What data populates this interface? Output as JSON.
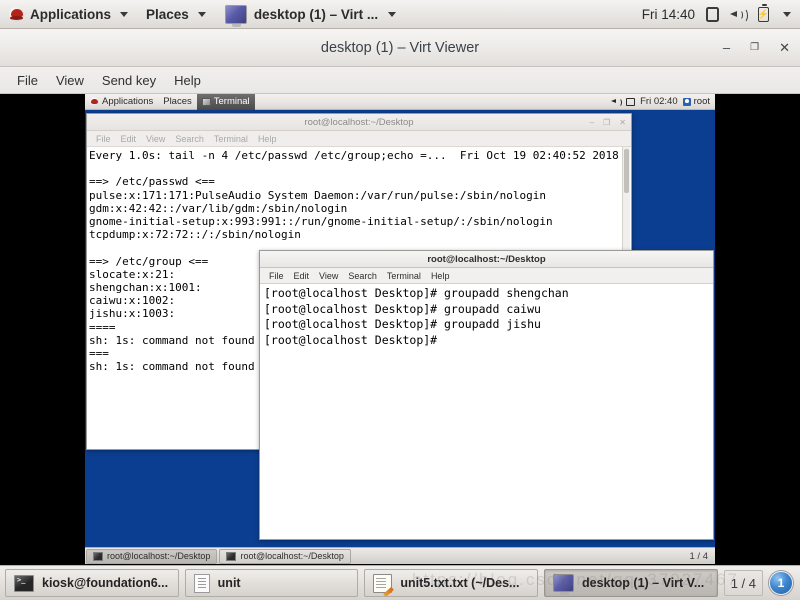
{
  "host_panel": {
    "applications": "Applications",
    "places": "Places",
    "window_title": "desktop (1) – Virt ...",
    "clock": "Fri 14:40",
    "icons": [
      "hat-icon",
      "chevron-down-icon",
      "display-icon",
      "network-icon",
      "volume-icon",
      "battery-icon"
    ]
  },
  "virt_viewer": {
    "title": "desktop (1) – Virt Viewer",
    "buttons": {
      "minimize": "–",
      "maximize": "❐",
      "close": "✕"
    },
    "menu": [
      "File",
      "View",
      "Send key",
      "Help"
    ]
  },
  "guest_panel": {
    "applications": "Applications",
    "places": "Places",
    "task": "Terminal",
    "clock": "Fri 02:40",
    "user": "root"
  },
  "bg_terminal": {
    "title": "root@localhost:~/Desktop",
    "menu": [
      "File",
      "Edit",
      "View",
      "Search",
      "Terminal",
      "Help"
    ],
    "lines": [
      "Every 1.0s: tail -n 4 /etc/passwd /etc/group;echo =...  Fri Oct 19 02:40:52 2018",
      "",
      "==> /etc/passwd <==",
      "pulse:x:171:171:PulseAudio System Daemon:/var/run/pulse:/sbin/nologin",
      "gdm:x:42:42::/var/lib/gdm:/sbin/nologin",
      "gnome-initial-setup:x:993:991::/run/gnome-initial-setup/:/sbin/nologin",
      "tcpdump:x:72:72::/:/sbin/nologin",
      "",
      "==> /etc/group <==",
      "slocate:x:21:",
      "shengchan:x:1001:",
      "caiwu:x:1002:",
      "jishu:x:1003:",
      "====",
      "sh: 1s: command not found",
      "===",
      "sh: 1s: command not found"
    ]
  },
  "fg_terminal": {
    "title": "root@localhost:~/Desktop",
    "menu": [
      "File",
      "Edit",
      "View",
      "Search",
      "Terminal",
      "Help"
    ],
    "lines": [
      "[root@localhost Desktop]# groupadd shengchan",
      "[root@localhost Desktop]# groupadd caiwu",
      "[root@localhost Desktop]# groupadd jishu",
      "[root@localhost Desktop]#"
    ]
  },
  "guest_taskbar": {
    "items": [
      "root@localhost:~/Desktop",
      "root@localhost:~/Desktop"
    ],
    "workspace": "1 / 4"
  },
  "host_taskbar": {
    "items": [
      {
        "label": "kiosk@foundation6...",
        "icon": "terminal-icon",
        "active": false
      },
      {
        "label": "unit",
        "icon": "file-manager-icon",
        "active": false
      },
      {
        "label": "unit5.txt.txt (~/Des...",
        "icon": "text-editor-icon",
        "active": false
      },
      {
        "label": "desktop (1) – Virt V...",
        "icon": "virt-viewer-icon",
        "active": true
      }
    ],
    "workspace": "1 / 4",
    "badge": "1"
  },
  "watermark": "https://blog.csdn.net/qq_37027467",
  "colors": {
    "desktop_blue": "#0b3e90",
    "panel_grey": "#e4e1dd",
    "letterbox": "#000000"
  }
}
